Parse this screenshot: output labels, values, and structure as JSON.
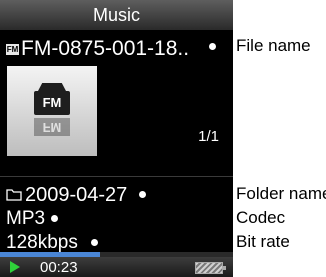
{
  "screen": {
    "title": "Music",
    "file_name": "FM-0875-001-18..",
    "file_icon_text": "FM",
    "artwork_text": "FM",
    "track_position": "1/1",
    "folder_name": "2009-04-27",
    "codec": "MP3",
    "bit_rate": "128kbps",
    "elapsed_time": "00:23",
    "playback_progress": 0.43
  },
  "labels": {
    "file_name": "File name",
    "folder_name": "Folder name",
    "codec": "Codec",
    "bit_rate": "Bit rate"
  },
  "colors": {
    "progress_fill": "#4a86d6",
    "play_icon": "#2fd13a"
  },
  "icons": {
    "file": "fm-file-icon",
    "folder": "folder-icon",
    "play": "play-icon",
    "battery": "battery-icon"
  }
}
